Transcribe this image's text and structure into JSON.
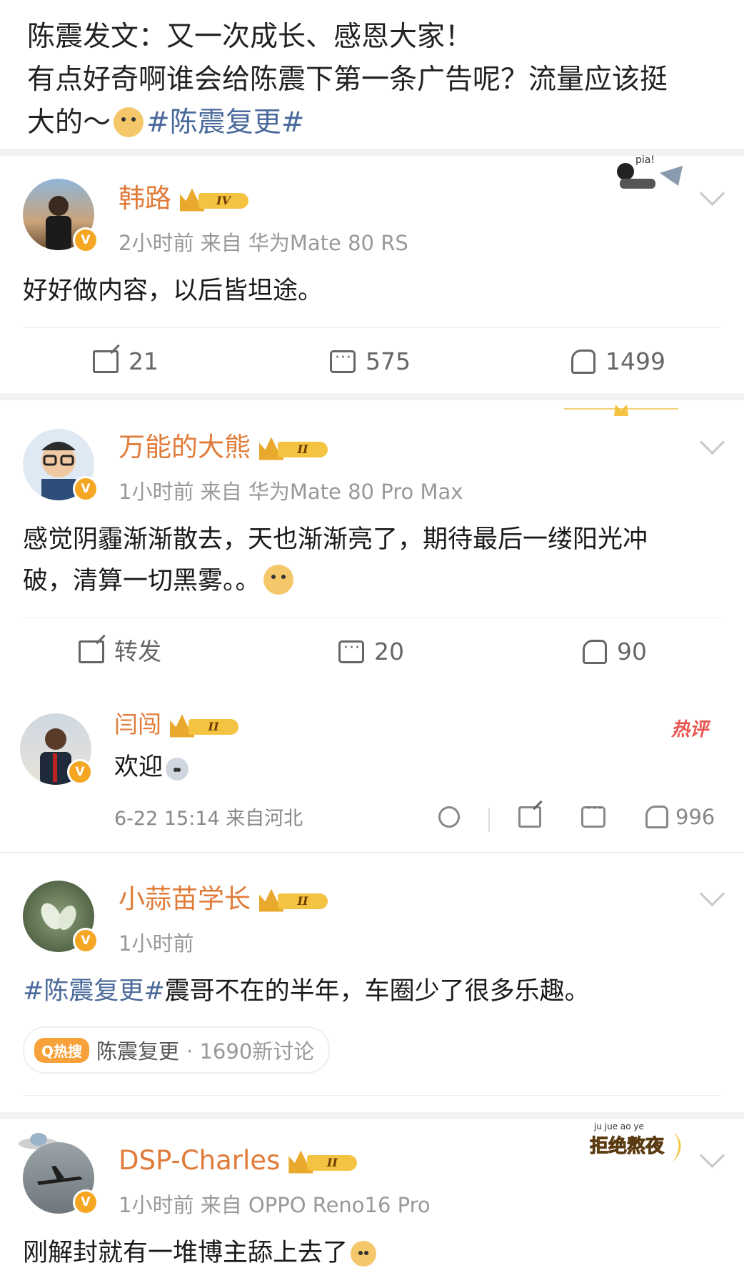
{
  "post": {
    "line1": "陈震发文：又一次成长、感恩大家！",
    "line2": "有点好奇啊谁会给陈震下第一条广告呢？流量应该挺",
    "line3_pre": "大的～",
    "hashtag": "#陈震复更#"
  },
  "comments": [
    {
      "name": "韩路",
      "level": "IV",
      "meta": "2小时前  来自 华为Mate 80 RS",
      "text": "好好做内容，以后皆坦途。",
      "share": "21",
      "comments": "575",
      "likes": "1499"
    },
    {
      "name": "万能的大熊",
      "level": "II",
      "meta": "1小时前  来自 华为Mate 80 Pro Max",
      "text1": "感觉阴霾渐渐散去，天也渐渐亮了，期待最后一缕阳光冲",
      "text2": "破，清算一切黑雾。。",
      "share": "转发",
      "comments": "20",
      "likes": "90",
      "reply": {
        "name": "闫闯",
        "level": "II",
        "text": "欢迎",
        "meta": "6-22 15:14 来自河北",
        "likes": "996",
        "badge": "热评"
      }
    },
    {
      "name": "小蒜苗学长",
      "level": "II",
      "meta": "1小时前",
      "hashtag": "#陈震复更#",
      "text": "震哥不在的半年，车圈少了很多乐趣。",
      "hot_label": "热搜",
      "hot_topic": "陈震复更",
      "hot_count": "· 1690新讨论"
    },
    {
      "name": "DSP-Charles",
      "level": "II",
      "meta": "1小时前  来自 OPPO Reno16 Pro",
      "text": "刚解封就有一堆博主舔上去了",
      "sticker": "拒绝熬夜",
      "sticker_pinyin": "ju jue ao ye"
    }
  ],
  "deco": {
    "pia": "pia!"
  },
  "colors": {
    "name": "#e07b39",
    "hashtag": "#4a6a9b",
    "meta": "#999999",
    "vip": "#f5c342"
  }
}
